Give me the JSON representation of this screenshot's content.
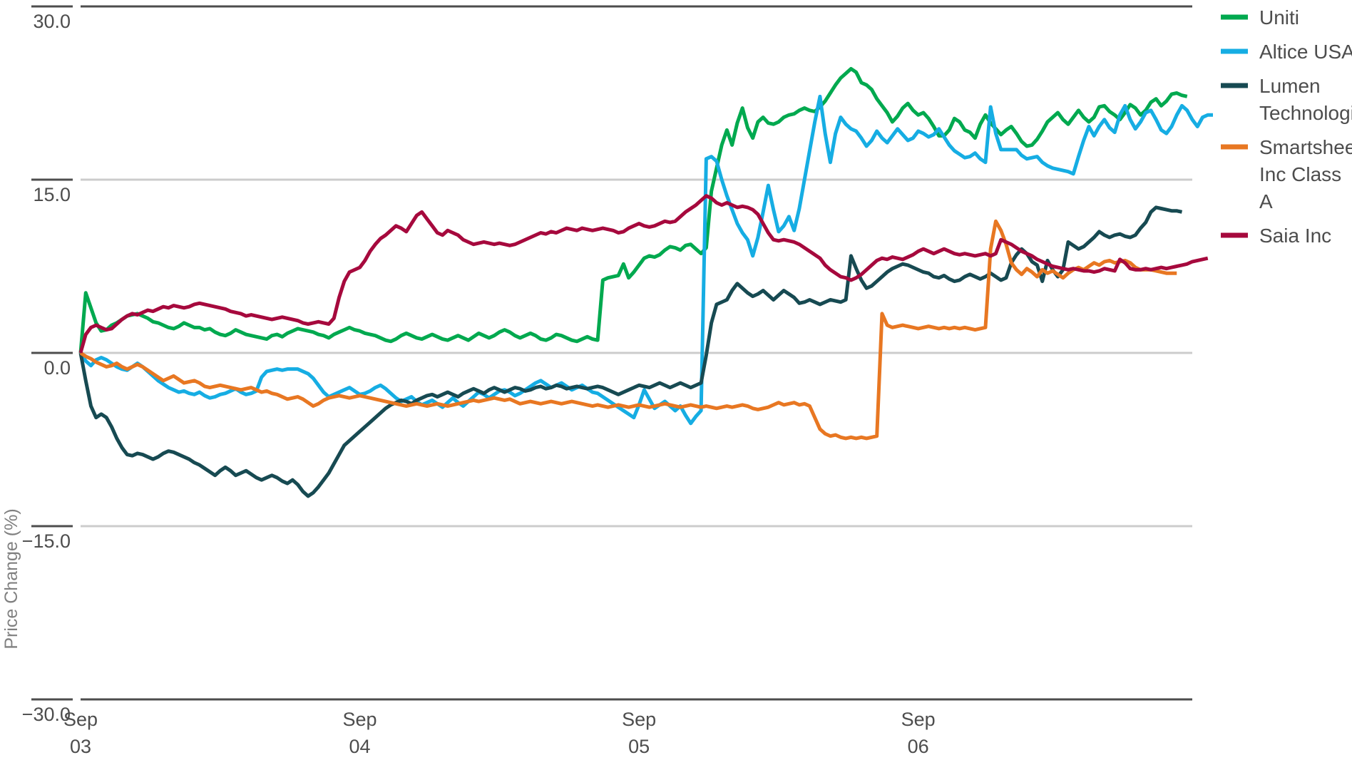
{
  "chart_data": {
    "type": "line",
    "title": "",
    "subtitle": "",
    "xlabel": "",
    "ylabel": "Price Change (%)",
    "ylim": [
      -30.0,
      30.0
    ],
    "yticks": [
      30.0,
      15.0,
      0.0,
      -15.0,
      -30.0
    ],
    "ytick_labels": [
      "30.0",
      "15.0",
      "0.0",
      "−15.0",
      "−30.0"
    ],
    "xtick_labels": [
      "Sep\n03",
      "Sep\n04",
      "Sep\n05",
      "Sep\n06"
    ],
    "xticks": [
      {
        "line1": "Sep",
        "line2": "03",
        "pos": 0
      },
      {
        "line1": "Sep",
        "line2": "04",
        "pos": 54
      },
      {
        "line1": "Sep",
        "line2": "05",
        "pos": 108
      },
      {
        "line1": "Sep",
        "line2": "06",
        "pos": 162
      }
    ],
    "grid": true,
    "grid_values": [
      15.0,
      0.0,
      -15.0
    ],
    "legend_position": "right",
    "x_count": 216,
    "series": [
      {
        "name": "Uniti",
        "color": "#00A94F",
        "values": [
          0.0,
          5.2,
          3.9,
          2.6,
          1.9,
          2.0,
          2.4,
          2.6,
          2.9,
          3.2,
          3.3,
          3.4,
          3.2,
          3.0,
          2.7,
          2.6,
          2.4,
          2.2,
          2.1,
          2.3,
          2.6,
          2.4,
          2.2,
          2.2,
          2.0,
          2.1,
          1.8,
          1.6,
          1.5,
          1.7,
          2.0,
          1.8,
          1.6,
          1.5,
          1.4,
          1.3,
          1.2,
          1.5,
          1.6,
          1.4,
          1.7,
          1.9,
          2.1,
          2.0,
          1.9,
          1.8,
          1.6,
          1.5,
          1.3,
          1.6,
          1.8,
          2.0,
          2.2,
          2.0,
          1.9,
          1.7,
          1.6,
          1.5,
          1.3,
          1.1,
          1.0,
          1.2,
          1.5,
          1.7,
          1.5,
          1.3,
          1.2,
          1.4,
          1.6,
          1.4,
          1.2,
          1.1,
          1.3,
          1.5,
          1.3,
          1.1,
          1.4,
          1.7,
          1.5,
          1.3,
          1.5,
          1.8,
          2.0,
          1.8,
          1.5,
          1.3,
          1.5,
          1.7,
          1.5,
          1.2,
          1.1,
          1.3,
          1.6,
          1.5,
          1.3,
          1.1,
          1.0,
          1.2,
          1.4,
          1.2,
          1.1,
          6.3,
          6.5,
          6.6,
          6.7,
          7.7,
          6.5,
          7.0,
          7.6,
          8.2,
          8.4,
          8.3,
          8.5,
          8.9,
          9.2,
          9.1,
          8.9,
          9.3,
          9.4,
          9.0,
          8.6,
          9.1,
          14.0,
          16.0,
          18.0,
          19.3,
          18.0,
          19.9,
          21.2,
          19.5,
          18.6,
          20.0,
          20.4,
          19.9,
          19.8,
          20.0,
          20.4,
          20.6,
          20.7,
          21.0,
          21.2,
          21.0,
          20.9,
          21.3,
          21.8,
          22.5,
          23.2,
          23.8,
          24.2,
          24.6,
          24.3,
          23.4,
          23.2,
          22.8,
          22.0,
          21.4,
          20.8,
          20.0,
          20.5,
          21.2,
          21.6,
          21.0,
          20.6,
          20.8,
          20.3,
          19.6,
          18.8,
          18.8,
          19.3,
          20.3,
          20.0,
          19.3,
          19.1,
          18.6,
          19.8,
          20.6,
          19.9,
          19.4,
          18.9,
          19.3,
          19.6,
          19.0,
          18.3,
          17.9,
          18.0,
          18.5,
          19.2,
          20.0,
          20.4,
          20.8,
          20.2,
          19.8,
          20.4,
          21.0,
          20.4,
          20.0,
          20.4,
          21.3,
          21.4,
          20.9,
          20.6,
          20.2,
          20.8,
          21.5,
          21.2,
          20.6,
          21.0,
          21.7,
          22.0,
          21.4,
          21.8,
          22.4,
          22.5,
          22.3,
          22.2
        ]
      },
      {
        "name": "Altice USA",
        "color": "#16ADE3",
        "values": [
          0.0,
          -0.7,
          -1.1,
          -0.6,
          -0.4,
          -0.6,
          -0.9,
          -1.2,
          -1.4,
          -1.5,
          -1.2,
          -0.9,
          -1.2,
          -1.6,
          -2.0,
          -2.4,
          -2.7,
          -3.0,
          -3.2,
          -3.4,
          -3.3,
          -3.5,
          -3.6,
          -3.4,
          -3.7,
          -3.9,
          -3.8,
          -3.6,
          -3.5,
          -3.3,
          -3.1,
          -3.4,
          -3.6,
          -3.5,
          -3.3,
          -2.1,
          -1.6,
          -1.5,
          -1.4,
          -1.5,
          -1.4,
          -1.4,
          -1.4,
          -1.6,
          -1.8,
          -2.2,
          -2.8,
          -3.4,
          -3.8,
          -3.6,
          -3.4,
          -3.2,
          -3.0,
          -3.3,
          -3.6,
          -3.5,
          -3.3,
          -3.0,
          -2.8,
          -3.1,
          -3.5,
          -3.9,
          -4.2,
          -4.0,
          -3.8,
          -4.2,
          -4.5,
          -4.3,
          -4.1,
          -4.4,
          -4.7,
          -4.3,
          -3.9,
          -4.3,
          -4.6,
          -4.2,
          -3.8,
          -3.4,
          -3.6,
          -3.9,
          -3.6,
          -3.3,
          -3.2,
          -3.4,
          -3.7,
          -3.5,
          -3.2,
          -2.9,
          -2.6,
          -2.4,
          -2.7,
          -3.0,
          -2.8,
          -2.6,
          -2.9,
          -3.2,
          -3.0,
          -2.8,
          -3.1,
          -3.4,
          -3.5,
          -3.8,
          -4.1,
          -4.4,
          -4.7,
          -5.0,
          -5.3,
          -5.6,
          -4.5,
          -3.2,
          -4.0,
          -4.8,
          -4.5,
          -4.2,
          -4.6,
          -5.0,
          -4.6,
          -5.4,
          -6.1,
          -5.5,
          -5.0,
          16.8,
          17.0,
          16.6,
          15.0,
          13.6,
          12.4,
          11.2,
          10.4,
          9.8,
          8.4,
          10.0,
          12.2,
          14.5,
          12.4,
          10.5,
          11.0,
          11.8,
          10.6,
          12.5,
          15.0,
          17.5,
          20.0,
          22.2,
          19.0,
          16.5,
          19.0,
          20.4,
          19.8,
          19.4,
          19.2,
          18.6,
          17.9,
          18.4,
          19.2,
          18.6,
          18.2,
          18.8,
          19.4,
          18.9,
          18.4,
          18.6,
          19.2,
          19.0,
          18.7,
          18.9,
          19.4,
          18.7,
          18.0,
          17.5,
          17.2,
          16.9,
          17.0,
          17.3,
          16.8,
          16.5,
          21.3,
          19.0,
          17.6,
          17.6,
          17.6,
          17.6,
          17.1,
          16.8,
          16.9,
          17.0,
          16.5,
          16.2,
          16.0,
          15.9,
          15.8,
          15.7,
          15.5,
          17.0,
          18.4,
          19.6,
          18.8,
          19.6,
          20.2,
          19.5,
          19.1,
          20.6,
          21.4,
          20.2,
          19.4,
          20.0,
          20.8,
          21.0,
          20.2,
          19.3,
          19.0,
          19.6,
          20.6,
          21.4,
          21.0,
          20.2,
          19.6,
          20.4,
          20.6,
          20.6
        ]
      },
      {
        "name": "Lumen Technologies",
        "color": "#174A52",
        "values": [
          0.0,
          -2.4,
          -4.6,
          -5.6,
          -5.3,
          -5.6,
          -6.4,
          -7.4,
          -8.2,
          -8.8,
          -8.9,
          -8.7,
          -8.8,
          -9.0,
          -9.2,
          -9.0,
          -8.7,
          -8.5,
          -8.6,
          -8.8,
          -9.0,
          -9.2,
          -9.5,
          -9.7,
          -10.0,
          -10.3,
          -10.6,
          -10.2,
          -9.9,
          -10.2,
          -10.6,
          -10.4,
          -10.2,
          -10.5,
          -10.8,
          -11.0,
          -10.8,
          -10.6,
          -10.8,
          -11.1,
          -11.3,
          -11.0,
          -11.4,
          -12.0,
          -12.4,
          -12.1,
          -11.6,
          -11.0,
          -10.4,
          -9.6,
          -8.8,
          -8.0,
          -7.6,
          -7.2,
          -6.8,
          -6.4,
          -6.0,
          -5.6,
          -5.2,
          -4.8,
          -4.5,
          -4.3,
          -4.1,
          -4.2,
          -4.4,
          -4.1,
          -3.9,
          -3.7,
          -3.6,
          -3.8,
          -3.6,
          -3.4,
          -3.6,
          -3.8,
          -3.5,
          -3.3,
          -3.1,
          -3.3,
          -3.5,
          -3.2,
          -3.0,
          -3.2,
          -3.4,
          -3.2,
          -3.0,
          -3.1,
          -3.3,
          -3.2,
          -3.0,
          -2.9,
          -3.1,
          -3.0,
          -2.8,
          -2.9,
          -3.1,
          -3.0,
          -2.9,
          -3.0,
          -3.1,
          -3.0,
          -2.9,
          -3.0,
          -3.2,
          -3.4,
          -3.6,
          -3.4,
          -3.2,
          -3.0,
          -2.8,
          -2.9,
          -3.0,
          -2.8,
          -2.6,
          -2.8,
          -3.0,
          -2.8,
          -2.6,
          -2.8,
          -3.0,
          -2.8,
          -2.6,
          -0.2,
          2.6,
          4.2,
          4.4,
          4.6,
          5.4,
          6.0,
          5.6,
          5.2,
          4.9,
          5.1,
          5.4,
          5.0,
          4.6,
          5.0,
          5.4,
          5.1,
          4.8,
          4.3,
          4.4,
          4.6,
          4.4,
          4.2,
          4.4,
          4.6,
          4.5,
          4.4,
          4.6,
          8.4,
          7.3,
          6.3,
          5.6,
          5.8,
          6.2,
          6.6,
          7.0,
          7.3,
          7.5,
          7.7,
          7.6,
          7.4,
          7.2,
          7.0,
          6.9,
          6.6,
          6.5,
          6.7,
          6.4,
          6.2,
          6.3,
          6.6,
          6.8,
          6.6,
          6.4,
          6.6,
          6.9,
          6.6,
          6.3,
          6.5,
          7.8,
          8.5,
          9.0,
          8.6,
          7.9,
          7.6,
          6.2,
          8.0,
          7.2,
          6.6,
          7.2,
          9.6,
          9.3,
          9.0,
          9.2,
          9.6,
          10.0,
          10.5,
          10.2,
          10.0,
          10.2,
          10.3,
          10.1,
          10.0,
          10.2,
          10.8,
          11.3,
          12.2,
          12.6,
          12.5,
          12.4,
          12.3,
          12.3,
          12.2
        ]
      },
      {
        "name": "Smartsheet Inc Class A",
        "color": "#E87722",
        "values": [
          0.0,
          -0.3,
          -0.5,
          -0.8,
          -1.0,
          -1.2,
          -1.1,
          -0.9,
          -1.2,
          -1.4,
          -1.2,
          -1.0,
          -1.2,
          -1.5,
          -1.8,
          -2.1,
          -2.4,
          -2.2,
          -2.0,
          -2.3,
          -2.6,
          -2.5,
          -2.4,
          -2.6,
          -2.9,
          -3.0,
          -2.9,
          -2.8,
          -2.9,
          -3.0,
          -3.1,
          -3.2,
          -3.1,
          -3.0,
          -3.2,
          -3.4,
          -3.3,
          -3.5,
          -3.6,
          -3.8,
          -4.0,
          -3.9,
          -3.8,
          -4.0,
          -4.3,
          -4.6,
          -4.4,
          -4.1,
          -3.9,
          -3.8,
          -3.7,
          -3.8,
          -3.9,
          -3.8,
          -3.7,
          -3.8,
          -3.9,
          -4.0,
          -4.1,
          -4.2,
          -4.3,
          -4.4,
          -4.5,
          -4.6,
          -4.5,
          -4.4,
          -4.5,
          -4.6,
          -4.5,
          -4.4,
          -4.5,
          -4.6,
          -4.5,
          -4.4,
          -4.3,
          -4.2,
          -4.1,
          -4.2,
          -4.1,
          -4.0,
          -3.9,
          -4.0,
          -4.1,
          -4.0,
          -4.2,
          -4.4,
          -4.3,
          -4.2,
          -4.3,
          -4.4,
          -4.3,
          -4.2,
          -4.3,
          -4.4,
          -4.3,
          -4.2,
          -4.3,
          -4.4,
          -4.5,
          -4.6,
          -4.5,
          -4.6,
          -4.7,
          -4.6,
          -4.5,
          -4.6,
          -4.7,
          -4.6,
          -4.5,
          -4.6,
          -4.7,
          -4.6,
          -4.5,
          -4.4,
          -4.5,
          -4.6,
          -4.7,
          -4.6,
          -4.5,
          -4.6,
          -4.7,
          -4.6,
          -4.7,
          -4.8,
          -4.7,
          -4.6,
          -4.7,
          -4.6,
          -4.5,
          -4.6,
          -4.8,
          -4.9,
          -4.8,
          -4.7,
          -4.5,
          -4.3,
          -4.5,
          -4.4,
          -4.3,
          -4.5,
          -4.4,
          -4.6,
          -5.6,
          -6.6,
          -7.0,
          -7.2,
          -7.1,
          -7.3,
          -7.4,
          -7.3,
          -7.4,
          -7.3,
          -7.4,
          -7.3,
          -7.2,
          3.4,
          2.4,
          2.2,
          2.3,
          2.4,
          2.3,
          2.2,
          2.1,
          2.2,
          2.3,
          2.2,
          2.1,
          2.2,
          2.1,
          2.2,
          2.1,
          2.2,
          2.1,
          2.0,
          2.1,
          2.2,
          9.0,
          11.4,
          10.6,
          9.4,
          7.8,
          7.2,
          6.8,
          7.3,
          7.0,
          6.6,
          7.2,
          6.9,
          7.1,
          6.8,
          6.5,
          6.9,
          7.2,
          7.4,
          7.2,
          7.5,
          7.8,
          7.6,
          7.9,
          8.0,
          7.8,
          7.9,
          8.0,
          7.8,
          7.4,
          7.2,
          7.2,
          7.2,
          7.1,
          7.0,
          6.9,
          6.9,
          6.9
        ]
      },
      {
        "name": "Saia Inc",
        "color": "#A6093D",
        "values": [
          0.0,
          1.6,
          2.2,
          2.4,
          2.2,
          2.0,
          2.1,
          2.5,
          2.9,
          3.2,
          3.4,
          3.3,
          3.5,
          3.7,
          3.6,
          3.8,
          4.0,
          3.9,
          4.1,
          4.0,
          3.9,
          4.0,
          4.2,
          4.3,
          4.2,
          4.1,
          4.0,
          3.9,
          3.8,
          3.6,
          3.5,
          3.4,
          3.2,
          3.3,
          3.2,
          3.1,
          3.0,
          2.9,
          3.0,
          3.1,
          3.0,
          2.9,
          2.8,
          2.6,
          2.5,
          2.6,
          2.7,
          2.6,
          2.5,
          3.0,
          4.8,
          6.2,
          7.0,
          7.2,
          7.4,
          8.0,
          8.8,
          9.4,
          9.9,
          10.2,
          10.6,
          11.0,
          10.8,
          10.5,
          11.2,
          11.9,
          12.2,
          11.6,
          11.0,
          10.4,
          10.2,
          10.6,
          10.4,
          10.2,
          9.8,
          9.6,
          9.4,
          9.5,
          9.6,
          9.5,
          9.4,
          9.5,
          9.4,
          9.3,
          9.4,
          9.6,
          9.8,
          10.0,
          10.2,
          10.4,
          10.3,
          10.5,
          10.4,
          10.6,
          10.8,
          10.7,
          10.6,
          10.8,
          10.7,
          10.6,
          10.7,
          10.8,
          10.7,
          10.6,
          10.4,
          10.5,
          10.8,
          11.0,
          11.2,
          11.0,
          10.9,
          11.0,
          11.2,
          11.4,
          11.3,
          11.4,
          11.8,
          12.2,
          12.5,
          12.8,
          13.2,
          13.6,
          13.4,
          13.0,
          12.8,
          13.0,
          12.8,
          12.6,
          12.7,
          12.6,
          12.4,
          12.0,
          11.2,
          10.4,
          9.8,
          9.7,
          9.8,
          9.7,
          9.6,
          9.4,
          9.1,
          8.8,
          8.5,
          8.2,
          7.6,
          7.2,
          6.9,
          6.6,
          6.5,
          6.3,
          6.5,
          6.8,
          7.2,
          7.6,
          8.0,
          8.2,
          8.1,
          8.3,
          8.2,
          8.1,
          8.3,
          8.5,
          8.8,
          9.0,
          8.8,
          8.6,
          8.8,
          9.0,
          8.8,
          8.6,
          8.5,
          8.6,
          8.5,
          8.4,
          8.5,
          8.6,
          8.4,
          8.6,
          9.8,
          9.6,
          9.4,
          9.1,
          8.8,
          8.6,
          8.4,
          8.1,
          7.9,
          7.7,
          7.5,
          7.4,
          7.3,
          7.2,
          7.3,
          7.2,
          7.1,
          7.1,
          7.0,
          7.1,
          7.3,
          7.2,
          7.1,
          8.1,
          7.8,
          7.3,
          7.2,
          7.2,
          7.3,
          7.2,
          7.3,
          7.4,
          7.3,
          7.4,
          7.5,
          7.6,
          7.7,
          7.9,
          8.0,
          8.1,
          8.2
        ]
      }
    ],
    "legend_entries": [
      {
        "label": "Uniti",
        "color": "#00A94F"
      },
      {
        "label": "Altice USA",
        "color": "#16ADE3"
      },
      {
        "label": "Lumen Technologies",
        "color": "#174A52"
      },
      {
        "label": "Smartsheet Inc Class A",
        "color": "#E87722"
      },
      {
        "label": "Saia Inc",
        "color": "#A6093D"
      }
    ]
  },
  "colors": {
    "axis": "#4d4d4d",
    "grid": "#cccccc",
    "tick_text": "#4d4d4d",
    "axis_title": "#808080",
    "background": "#ffffff"
  }
}
